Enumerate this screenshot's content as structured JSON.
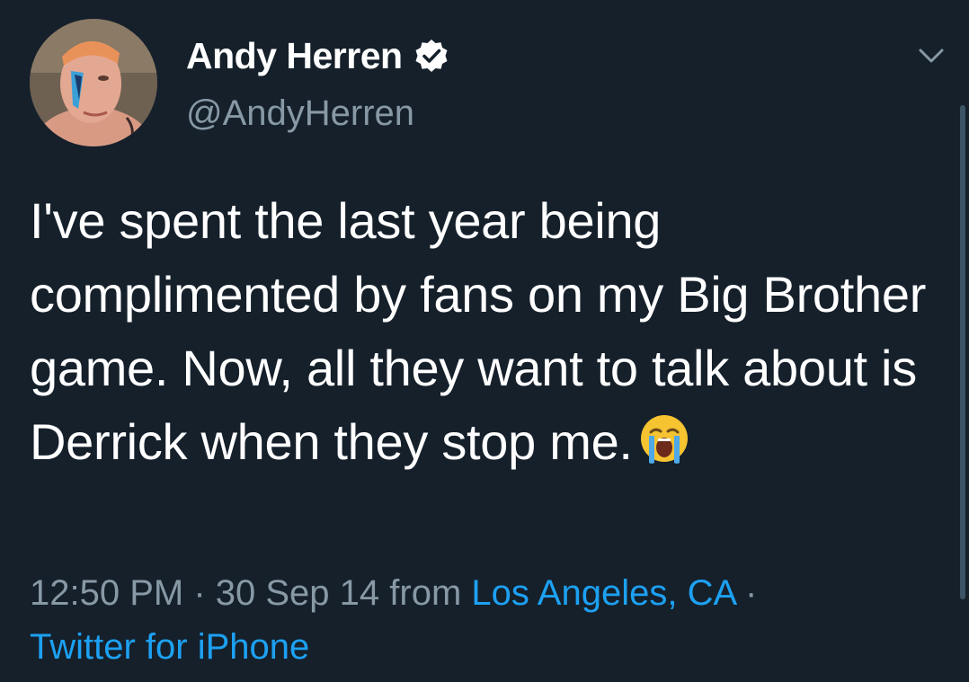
{
  "tweet": {
    "display_name": "Andy Herren",
    "handle": "@AndyHerren",
    "text": "I've spent the last year being complimented by fans on my Big Brother game. Now, all they want to talk about is Derrick when they stop me.",
    "time": "12:50 PM",
    "separator": " · ",
    "date": "30 Sep 14",
    "from_label": " from ",
    "location": "Los Angeles, CA",
    "trailing_separator": " ·",
    "source": "Twitter for iPhone"
  },
  "icons": {
    "verified": "verified-badge-icon",
    "caret": "chevron-down-icon",
    "emoji": "loudly-crying-face-emoji"
  },
  "colors": {
    "background": "#15202b",
    "text": "#ffffff",
    "secondary_text": "#8899a6",
    "link": "#1da1f2",
    "verified_badge": "#ffffff"
  }
}
